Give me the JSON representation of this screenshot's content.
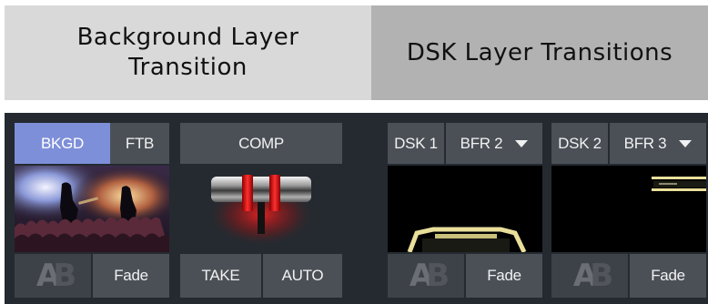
{
  "captions": {
    "left": [
      "Background Layer",
      "Transition"
    ],
    "right": "DSK Layer Transitions"
  },
  "bkgd": {
    "bkgd_label": "BKGD",
    "ftb_label": "FTB",
    "transition_label": "Fade"
  },
  "comp": {
    "comp_label": "COMP",
    "take_label": "TAKE",
    "auto_label": "AUTO"
  },
  "dsk1": {
    "label": "DSK 1",
    "source": "BFR 2",
    "transition_label": "Fade"
  },
  "dsk2": {
    "label": "DSK 2",
    "source": "BFR 3",
    "transition_label": "Fade"
  },
  "icons": {
    "ab_transition": "ab-transition-icon",
    "dropdown": "chevron-down-icon",
    "tbar": "t-bar-handle"
  },
  "colors": {
    "active_button": "#7e8fd9",
    "button": "#4b5057",
    "panel": "#242a30",
    "tbar_red": "#e02020"
  }
}
